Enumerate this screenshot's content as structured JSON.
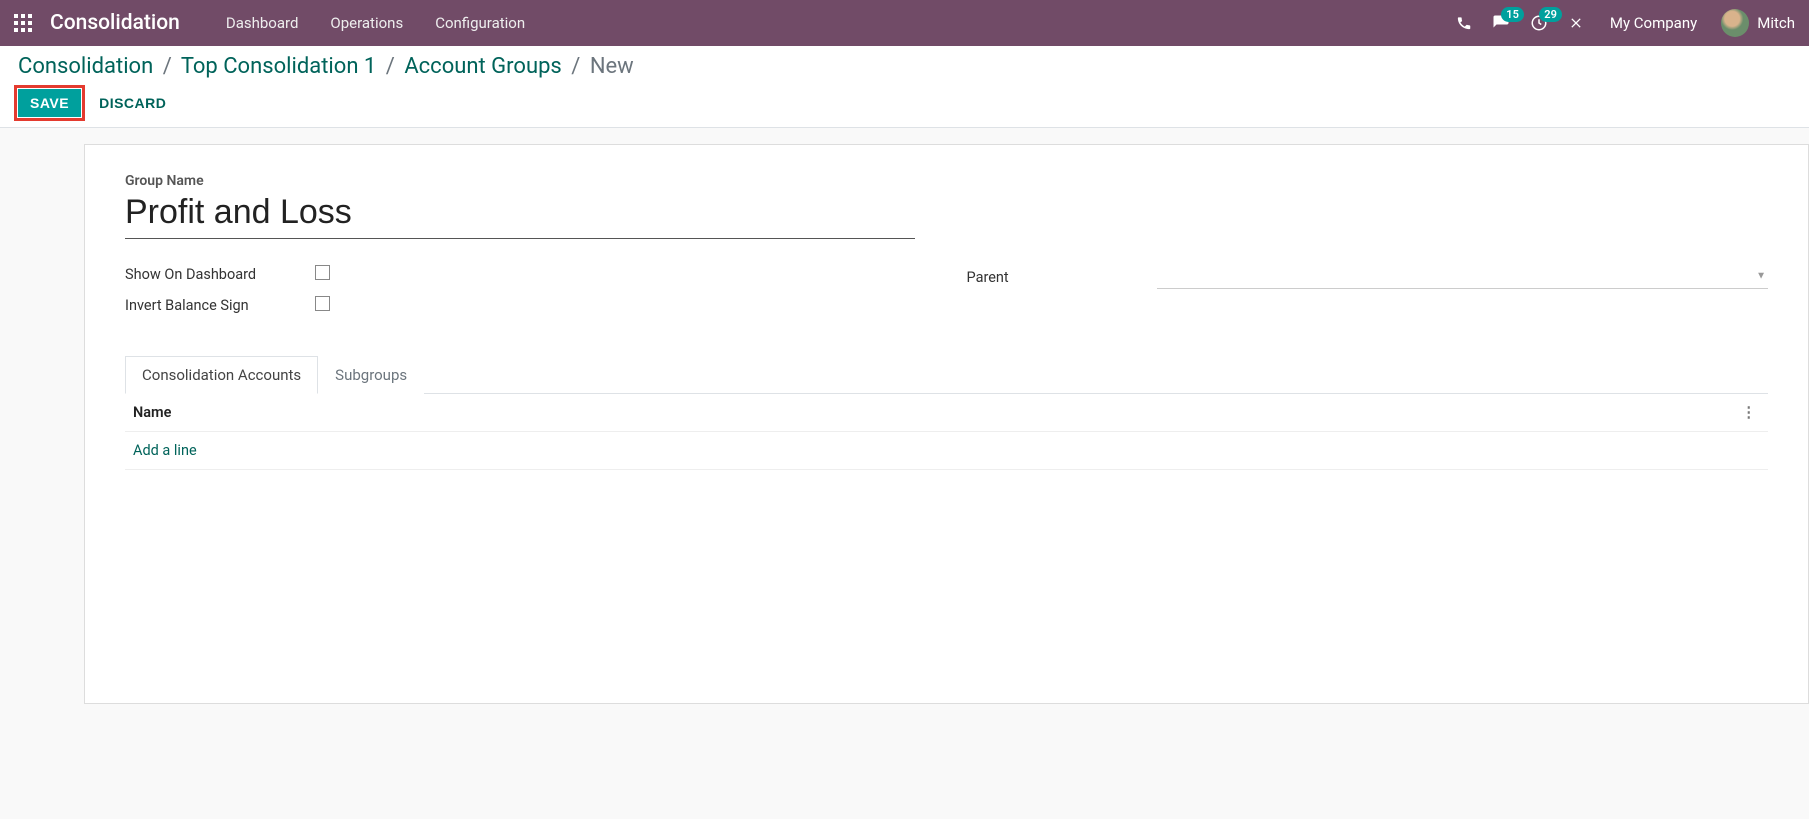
{
  "navbar": {
    "brand": "Consolidation",
    "menu": [
      "Dashboard",
      "Operations",
      "Configuration"
    ],
    "chat_badge": "15",
    "activity_badge": "29",
    "company": "My Company",
    "user": "Mitch"
  },
  "breadcrumb": {
    "items": [
      "Consolidation",
      "Top Consolidation 1",
      "Account Groups"
    ],
    "current": "New"
  },
  "buttons": {
    "save": "SAVE",
    "discard": "DISCARD"
  },
  "form": {
    "group_name_label": "Group Name",
    "group_name_value": "Profit and Loss",
    "show_on_dashboard_label": "Show On Dashboard",
    "invert_balance_sign_label": "Invert Balance Sign",
    "parent_label": "Parent",
    "parent_value": "",
    "tabs": [
      "Consolidation Accounts",
      "Subgroups"
    ],
    "active_tab_index": 0,
    "table": {
      "header_name": "Name",
      "add_line": "Add a line"
    }
  }
}
